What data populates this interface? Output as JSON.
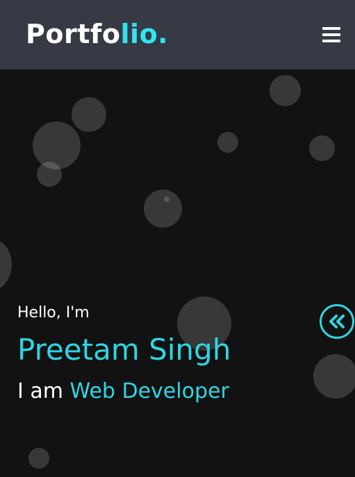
{
  "navbar": {
    "logo_main": "Portfo",
    "logo_accent": "lio.",
    "menu_icon": "hamburger-menu-icon"
  },
  "hero": {
    "greeting": "Hello, I'm",
    "name": "Preetam Singh",
    "role_prefix": "I am",
    "role": "Web Developer",
    "toggle_icon": "double-chevron-left-icon"
  },
  "colors": {
    "navbar_bg": "#373a44",
    "page_bg": "#121212",
    "accent": "#2fd6e3",
    "logo_accent": "#2ee6f0",
    "text": "#ffffff"
  }
}
